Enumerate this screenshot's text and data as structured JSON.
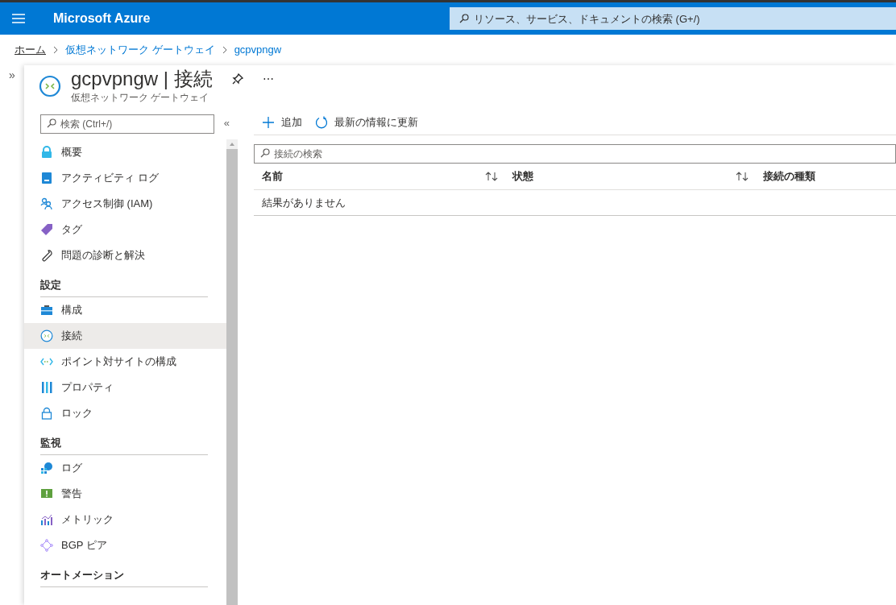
{
  "topbar": {
    "brand": "Microsoft Azure",
    "search": {
      "placeholder": "リソース、サービス、ドキュメントの検索 (G+/)"
    }
  },
  "breadcrumb": [
    {
      "label": "ホーム",
      "kind": "home"
    },
    {
      "label": "仮想ネットワーク ゲートウェイ",
      "kind": "link"
    },
    {
      "label": "gcpvpngw",
      "kind": "link"
    }
  ],
  "header": {
    "title": "gcpvpngw | 接続",
    "subtitle": "仮想ネットワーク ゲートウェイ"
  },
  "sidebar": {
    "search": {
      "placeholder": "検索 (Ctrl+/)"
    },
    "groups": [
      {
        "items": [
          {
            "label": "概要",
            "selected": false
          },
          {
            "label": "アクティビティ ログ",
            "selected": false
          },
          {
            "label": "アクセス制御 (IAM)",
            "selected": false
          },
          {
            "label": "タグ",
            "selected": false
          },
          {
            "label": "問題の診断と解決",
            "selected": false
          }
        ]
      },
      {
        "heading": "設定",
        "items": [
          {
            "label": "構成",
            "selected": false
          },
          {
            "label": "接続",
            "selected": true
          },
          {
            "label": "ポイント対サイトの構成",
            "selected": false
          },
          {
            "label": "プロパティ",
            "selected": false
          },
          {
            "label": "ロック",
            "selected": false
          }
        ]
      },
      {
        "heading": "監視",
        "items": [
          {
            "label": "ログ",
            "selected": false
          },
          {
            "label": "警告",
            "selected": false
          },
          {
            "label": "メトリック",
            "selected": false
          },
          {
            "label": "BGP ピア",
            "selected": false
          }
        ]
      },
      {
        "heading": "オートメーション"
      }
    ]
  },
  "glyphs": {
    "expand": "»",
    "collapse": "«",
    "more": "⋯"
  },
  "toolbar": [
    {
      "label": "追加",
      "kind": "add"
    },
    {
      "label": "最新の情報に更新",
      "kind": "refresh"
    }
  ],
  "table": {
    "search": {
      "placeholder": "接続の検索"
    },
    "columns": [
      {
        "label": "名前",
        "sortable": true
      },
      {
        "label": "状態",
        "sortable": true
      },
      {
        "label": "接続の種類",
        "sortable": false
      }
    ],
    "empty": "結果がありません"
  }
}
